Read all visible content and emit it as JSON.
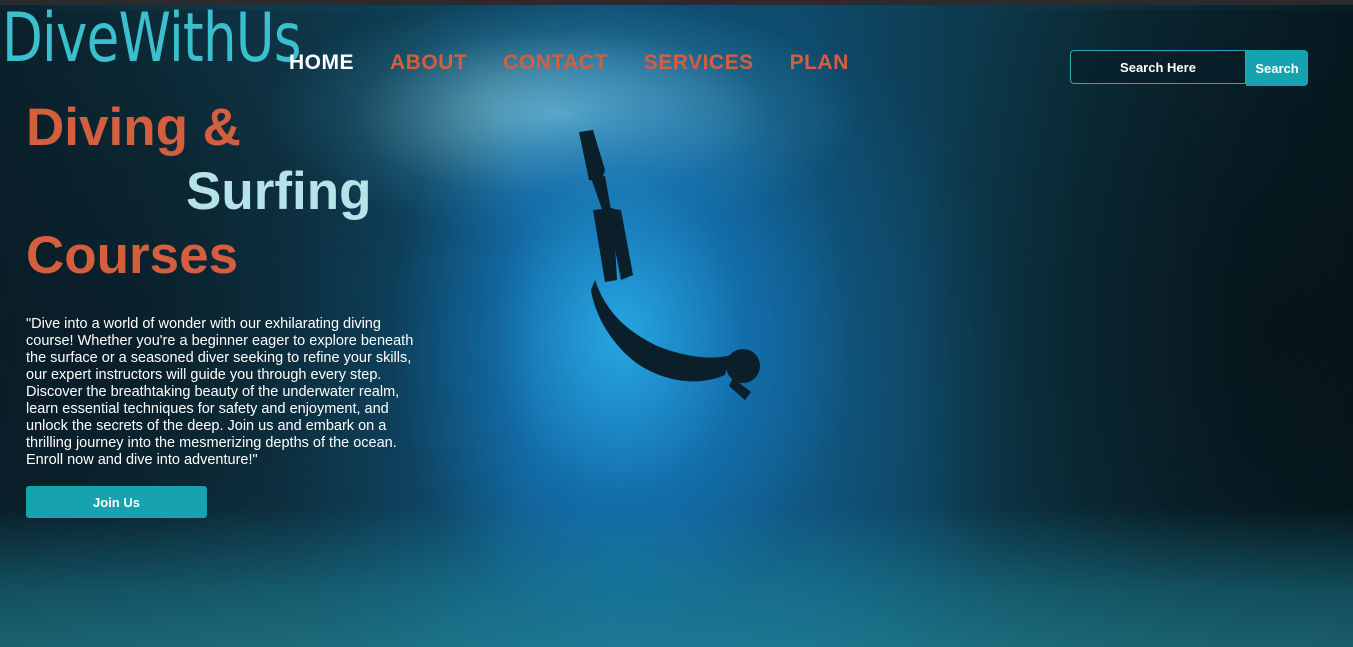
{
  "brand": {
    "logo_text": "DiveWithUs"
  },
  "nav": {
    "items": [
      {
        "label": "HOME",
        "active": true
      },
      {
        "label": "ABOUT",
        "active": false
      },
      {
        "label": "CONTACT",
        "active": false
      },
      {
        "label": "SERVICES",
        "active": false
      },
      {
        "label": "PLAN",
        "active": false
      }
    ]
  },
  "search": {
    "placeholder": "Search Here",
    "button_label": "Search"
  },
  "hero": {
    "title_line1": "Diving &",
    "title_line2": "Surfing",
    "title_line3": "Courses",
    "description": "\"Dive into a world of wonder with our exhilarating diving course! Whether you're a beginner eager to explore beneath the surface or a seasoned diver seeking to refine your skills, our expert instructors will guide you through every step. Discover the breathtaking beauty of the underwater realm, learn essential techniques for safety and enjoyment, and unlock the secrets of the deep. Join us and embark on a thrilling journey into the mesmerizing depths of the ocean. Enroll now and dive into adventure!\"",
    "cta_label": "Join Us"
  },
  "colors": {
    "accent_orange": "#d35f3e",
    "accent_teal": "#17a2b0",
    "logo_teal": "#3bbfcc",
    "title_light": "#b6e3ea"
  }
}
